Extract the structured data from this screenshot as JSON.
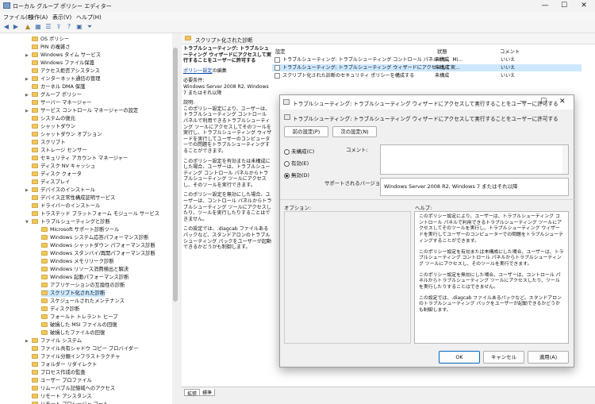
{
  "window": {
    "title": "ローカル グループ ポリシー エディター",
    "minimize": "—",
    "maximize": "☐",
    "close": "✕"
  },
  "menu": [
    "ファイル(F)",
    "操作(A)",
    "表示(V)",
    "ヘルプ(H)"
  ],
  "tree": {
    "items": [
      {
        "label": "OS ポリシー",
        "indent": 1
      },
      {
        "label": "PIN の複雑さ",
        "indent": 1
      },
      {
        "label": "Windows タイム サービス",
        "indent": 1,
        "caret": true
      },
      {
        "label": "Windows ファイル保護",
        "indent": 1
      },
      {
        "label": "アクセス拒否アシスタンス",
        "indent": 1
      },
      {
        "label": "インターネット通信の管理",
        "indent": 1,
        "caret": true
      },
      {
        "label": "カーネル DMA 保護",
        "indent": 1
      },
      {
        "label": "グループ ポリシー",
        "indent": 1,
        "caret": true
      },
      {
        "label": "サーバー マネージャー",
        "indent": 1
      },
      {
        "label": "サービス コントロール マネージャーの設定",
        "indent": 1,
        "caret": true
      },
      {
        "label": "システムの復元",
        "indent": 1
      },
      {
        "label": "シャットダウン",
        "indent": 1
      },
      {
        "label": "シャットダウン オプション",
        "indent": 1
      },
      {
        "label": "スクリプト",
        "indent": 1
      },
      {
        "label": "ストレージ センサー",
        "indent": 1
      },
      {
        "label": "セキュリティ アカウント マネージャー",
        "indent": 1
      },
      {
        "label": "ディスク NV キャッシュ",
        "indent": 1
      },
      {
        "label": "ディスク クォータ",
        "indent": 1
      },
      {
        "label": "ディスプレイ",
        "indent": 1
      },
      {
        "label": "デバイスのインストール",
        "indent": 1,
        "caret": true
      },
      {
        "label": "デバイス正常性構成証明サービス",
        "indent": 1
      },
      {
        "label": "ドライバーのインストール",
        "indent": 1
      },
      {
        "label": "トラステッド プラットフォーム モジュール サービス",
        "indent": 1
      },
      {
        "label": "トラブルシューティングと診断",
        "indent": 1,
        "caret": true,
        "expanded": true
      },
      {
        "label": "Microsoft サポート診断ツール",
        "indent": 2
      },
      {
        "label": "Windows システム応答パフォーマンス診断",
        "indent": 2
      },
      {
        "label": "Windows シャットダウン パフォーマンス診断",
        "indent": 2
      },
      {
        "label": "Windows スタンバイ/再開パフォーマンス診断",
        "indent": 2
      },
      {
        "label": "Windows メモリリーク診断",
        "indent": 2
      },
      {
        "label": "Windows リソース消費検出と解決",
        "indent": 2
      },
      {
        "label": "Windows 起動パフォーマンス診断",
        "indent": 2
      },
      {
        "label": "アプリケーションの互換性の診断",
        "indent": 2
      },
      {
        "label": "スクリプト化された診断",
        "indent": 2,
        "selected": true
      },
      {
        "label": "スケジュールされたメンテナンス",
        "indent": 2
      },
      {
        "label": "ディスク診断",
        "indent": 2
      },
      {
        "label": "フォールト トレラント ヒープ",
        "indent": 2
      },
      {
        "label": "破損した MSI ファイルの回復",
        "indent": 2
      },
      {
        "label": "破損したファイルの回復",
        "indent": 2
      },
      {
        "label": "ファイル システム",
        "indent": 1,
        "caret": true
      },
      {
        "label": "ファイル共有シャドウ コピー プロバイダー",
        "indent": 1
      },
      {
        "label": "ファイル分類インフラストラクチャ",
        "indent": 1
      },
      {
        "label": "フォルダー リダイレクト",
        "indent": 1
      },
      {
        "label": "プロセス作成の監査",
        "indent": 1
      },
      {
        "label": "ユーザー プロファイル",
        "indent": 1
      },
      {
        "label": "リムーバブル記憶域へのアクセス",
        "indent": 1
      },
      {
        "label": "リモート アシスタンス",
        "indent": 1
      },
      {
        "label": "リモート プロシージャ コール",
        "indent": 1
      }
    ]
  },
  "right": {
    "header": "スクリプト化された診断",
    "policy_title": "トラブルシューティング: トラブルシューティング ウィザードにアクセスして実行することをユーザーに許可する",
    "edit_link": "ポリシー設定",
    "edit_suffix": "の編集",
    "req_label": "必要条件:",
    "req_value": "Windows Server 2008 R2, Windows 7 またはそれ以降",
    "desc_label": "説明:",
    "desc_1": "このポリシー設定により、ユーザーは、トラブルシューティング コントロール パネルで利用できるトラブルシューティング ツールにアクセスしてそのツールを実行し、トラブルシューティング ウィザードを実行してユーザーのコンピューターでの問題をトラブルシューティングすることができます。",
    "desc_2": "このポリシー設定を有効または未構成にした場合、ユーザーは、トラブルシューティング コントロール パネルからトラブルシューティング ツールにアクセスし、そのツールを実行できます。",
    "desc_3": "このポリシー設定を無効にした場合、ユーザーは、コントロール パネルからトラブルシューティング ツールにアクセスしたり、ツールを実行したりすることはできません。",
    "desc_4": "この設定では、.diagcab ファイルあるパックなど、スタンドアロンのトラブルシューティング パックをユーザーが起動できるかどうかも制御します。",
    "cols": {
      "setting": "設定",
      "state": "状態",
      "comment": "コメント"
    },
    "rows": [
      {
        "name": "トラブルシューティング: トラブルシューティング コントロール パネルから、Mi...",
        "state": "未構成",
        "comment": "いいえ"
      },
      {
        "name": "トラブルシューティング: トラブルシューティング ウィザードにアクセスして実...",
        "state": "未構成",
        "comment": "いいえ"
      },
      {
        "name": "スクリプト化された診断のセキュリティ ポリシーを構成する",
        "state": "未構成",
        "comment": "いいえ"
      }
    ],
    "tabs": [
      "拡張",
      "標準"
    ]
  },
  "dialog": {
    "title": "トラブルシューティング: トラブルシューティング ウィザードにアクセスして実行することをユーザーに許可する",
    "header": "トラブルシューティング: トラブルシューティング ウィザードにアクセスして実行することをユーザーに許可する",
    "prev": "前の設定(P)",
    "next": "次の設定(N)",
    "r1": "未構成(C)",
    "r2": "有効(E)",
    "r3": "無効(D)",
    "comment_label": "コメント:",
    "supported_label": "サポートされるバージョン:",
    "supported_value": "Windows Server 2008 R2, Windows 7 またはそれ以降",
    "options_label": "オプション:",
    "help_label": "ヘルプ:",
    "help_1": "このポリシー設定により、ユーザーは、トラブルシューティング コントロール パネルで利用できるトラブルシューティング ツールにアクセスしてそのツールを実行し、トラブルシューティング ウィザードを実行してユーザーのコンピューターでの問題をトラブルシューティングすることができます。",
    "help_2": "このポリシー設定を有効または未構成にした場合、ユーザーは、トラブルシューティング コントロール パネルからトラブルシューティング ツールにアクセスし、そのツールを実行できます。",
    "help_3": "このポリシー設定を無効にした場合、ユーザーは、コントロール パネルからトラブルシューティング ツールにアクセスしたり、ツールを実行したりすることはできません。",
    "help_4": "この設定では、.diagcab ファイルあるパックなど、スタンドアロンのトラブルシューティング パックをユーザーが起動できるかどうかも制御します。",
    "ok": "OK",
    "cancel": "キャンセル",
    "apply": "適用(A)"
  }
}
